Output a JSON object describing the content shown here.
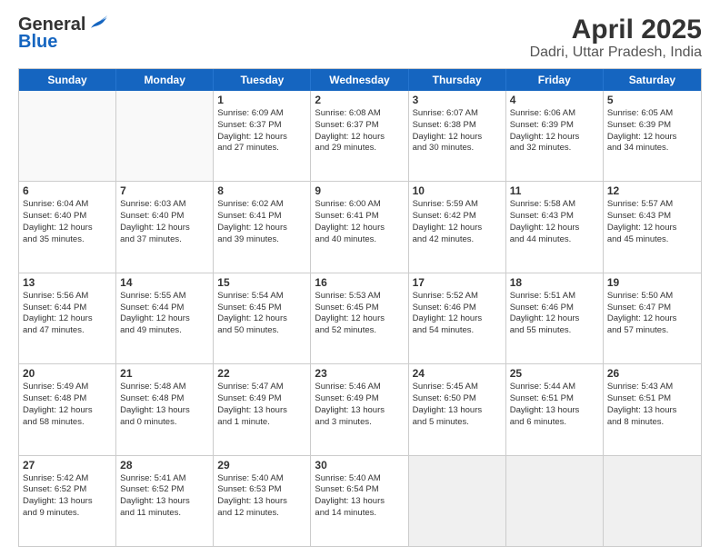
{
  "logo": {
    "line1": "General",
    "line2": "Blue"
  },
  "title": "April 2025",
  "subtitle": "Dadri, Uttar Pradesh, India",
  "weekdays": [
    "Sunday",
    "Monday",
    "Tuesday",
    "Wednesday",
    "Thursday",
    "Friday",
    "Saturday"
  ],
  "rows": [
    [
      {
        "day": "",
        "lines": [],
        "empty": true
      },
      {
        "day": "",
        "lines": [],
        "empty": true
      },
      {
        "day": "1",
        "lines": [
          "Sunrise: 6:09 AM",
          "Sunset: 6:37 PM",
          "Daylight: 12 hours",
          "and 27 minutes."
        ]
      },
      {
        "day": "2",
        "lines": [
          "Sunrise: 6:08 AM",
          "Sunset: 6:37 PM",
          "Daylight: 12 hours",
          "and 29 minutes."
        ]
      },
      {
        "day": "3",
        "lines": [
          "Sunrise: 6:07 AM",
          "Sunset: 6:38 PM",
          "Daylight: 12 hours",
          "and 30 minutes."
        ]
      },
      {
        "day": "4",
        "lines": [
          "Sunrise: 6:06 AM",
          "Sunset: 6:39 PM",
          "Daylight: 12 hours",
          "and 32 minutes."
        ]
      },
      {
        "day": "5",
        "lines": [
          "Sunrise: 6:05 AM",
          "Sunset: 6:39 PM",
          "Daylight: 12 hours",
          "and 34 minutes."
        ]
      }
    ],
    [
      {
        "day": "6",
        "lines": [
          "Sunrise: 6:04 AM",
          "Sunset: 6:40 PM",
          "Daylight: 12 hours",
          "and 35 minutes."
        ]
      },
      {
        "day": "7",
        "lines": [
          "Sunrise: 6:03 AM",
          "Sunset: 6:40 PM",
          "Daylight: 12 hours",
          "and 37 minutes."
        ]
      },
      {
        "day": "8",
        "lines": [
          "Sunrise: 6:02 AM",
          "Sunset: 6:41 PM",
          "Daylight: 12 hours",
          "and 39 minutes."
        ]
      },
      {
        "day": "9",
        "lines": [
          "Sunrise: 6:00 AM",
          "Sunset: 6:41 PM",
          "Daylight: 12 hours",
          "and 40 minutes."
        ]
      },
      {
        "day": "10",
        "lines": [
          "Sunrise: 5:59 AM",
          "Sunset: 6:42 PM",
          "Daylight: 12 hours",
          "and 42 minutes."
        ]
      },
      {
        "day": "11",
        "lines": [
          "Sunrise: 5:58 AM",
          "Sunset: 6:43 PM",
          "Daylight: 12 hours",
          "and 44 minutes."
        ]
      },
      {
        "day": "12",
        "lines": [
          "Sunrise: 5:57 AM",
          "Sunset: 6:43 PM",
          "Daylight: 12 hours",
          "and 45 minutes."
        ]
      }
    ],
    [
      {
        "day": "13",
        "lines": [
          "Sunrise: 5:56 AM",
          "Sunset: 6:44 PM",
          "Daylight: 12 hours",
          "and 47 minutes."
        ]
      },
      {
        "day": "14",
        "lines": [
          "Sunrise: 5:55 AM",
          "Sunset: 6:44 PM",
          "Daylight: 12 hours",
          "and 49 minutes."
        ]
      },
      {
        "day": "15",
        "lines": [
          "Sunrise: 5:54 AM",
          "Sunset: 6:45 PM",
          "Daylight: 12 hours",
          "and 50 minutes."
        ]
      },
      {
        "day": "16",
        "lines": [
          "Sunrise: 5:53 AM",
          "Sunset: 6:45 PM",
          "Daylight: 12 hours",
          "and 52 minutes."
        ]
      },
      {
        "day": "17",
        "lines": [
          "Sunrise: 5:52 AM",
          "Sunset: 6:46 PM",
          "Daylight: 12 hours",
          "and 54 minutes."
        ]
      },
      {
        "day": "18",
        "lines": [
          "Sunrise: 5:51 AM",
          "Sunset: 6:46 PM",
          "Daylight: 12 hours",
          "and 55 minutes."
        ]
      },
      {
        "day": "19",
        "lines": [
          "Sunrise: 5:50 AM",
          "Sunset: 6:47 PM",
          "Daylight: 12 hours",
          "and 57 minutes."
        ]
      }
    ],
    [
      {
        "day": "20",
        "lines": [
          "Sunrise: 5:49 AM",
          "Sunset: 6:48 PM",
          "Daylight: 12 hours",
          "and 58 minutes."
        ]
      },
      {
        "day": "21",
        "lines": [
          "Sunrise: 5:48 AM",
          "Sunset: 6:48 PM",
          "Daylight: 13 hours",
          "and 0 minutes."
        ]
      },
      {
        "day": "22",
        "lines": [
          "Sunrise: 5:47 AM",
          "Sunset: 6:49 PM",
          "Daylight: 13 hours",
          "and 1 minute."
        ]
      },
      {
        "day": "23",
        "lines": [
          "Sunrise: 5:46 AM",
          "Sunset: 6:49 PM",
          "Daylight: 13 hours",
          "and 3 minutes."
        ]
      },
      {
        "day": "24",
        "lines": [
          "Sunrise: 5:45 AM",
          "Sunset: 6:50 PM",
          "Daylight: 13 hours",
          "and 5 minutes."
        ]
      },
      {
        "day": "25",
        "lines": [
          "Sunrise: 5:44 AM",
          "Sunset: 6:51 PM",
          "Daylight: 13 hours",
          "and 6 minutes."
        ]
      },
      {
        "day": "26",
        "lines": [
          "Sunrise: 5:43 AM",
          "Sunset: 6:51 PM",
          "Daylight: 13 hours",
          "and 8 minutes."
        ]
      }
    ],
    [
      {
        "day": "27",
        "lines": [
          "Sunrise: 5:42 AM",
          "Sunset: 6:52 PM",
          "Daylight: 13 hours",
          "and 9 minutes."
        ]
      },
      {
        "day": "28",
        "lines": [
          "Sunrise: 5:41 AM",
          "Sunset: 6:52 PM",
          "Daylight: 13 hours",
          "and 11 minutes."
        ]
      },
      {
        "day": "29",
        "lines": [
          "Sunrise: 5:40 AM",
          "Sunset: 6:53 PM",
          "Daylight: 13 hours",
          "and 12 minutes."
        ]
      },
      {
        "day": "30",
        "lines": [
          "Sunrise: 5:40 AM",
          "Sunset: 6:54 PM",
          "Daylight: 13 hours",
          "and 14 minutes."
        ]
      },
      {
        "day": "",
        "lines": [],
        "empty": true,
        "shaded": true
      },
      {
        "day": "",
        "lines": [],
        "empty": true,
        "shaded": true
      },
      {
        "day": "",
        "lines": [],
        "empty": true,
        "shaded": true
      }
    ]
  ]
}
